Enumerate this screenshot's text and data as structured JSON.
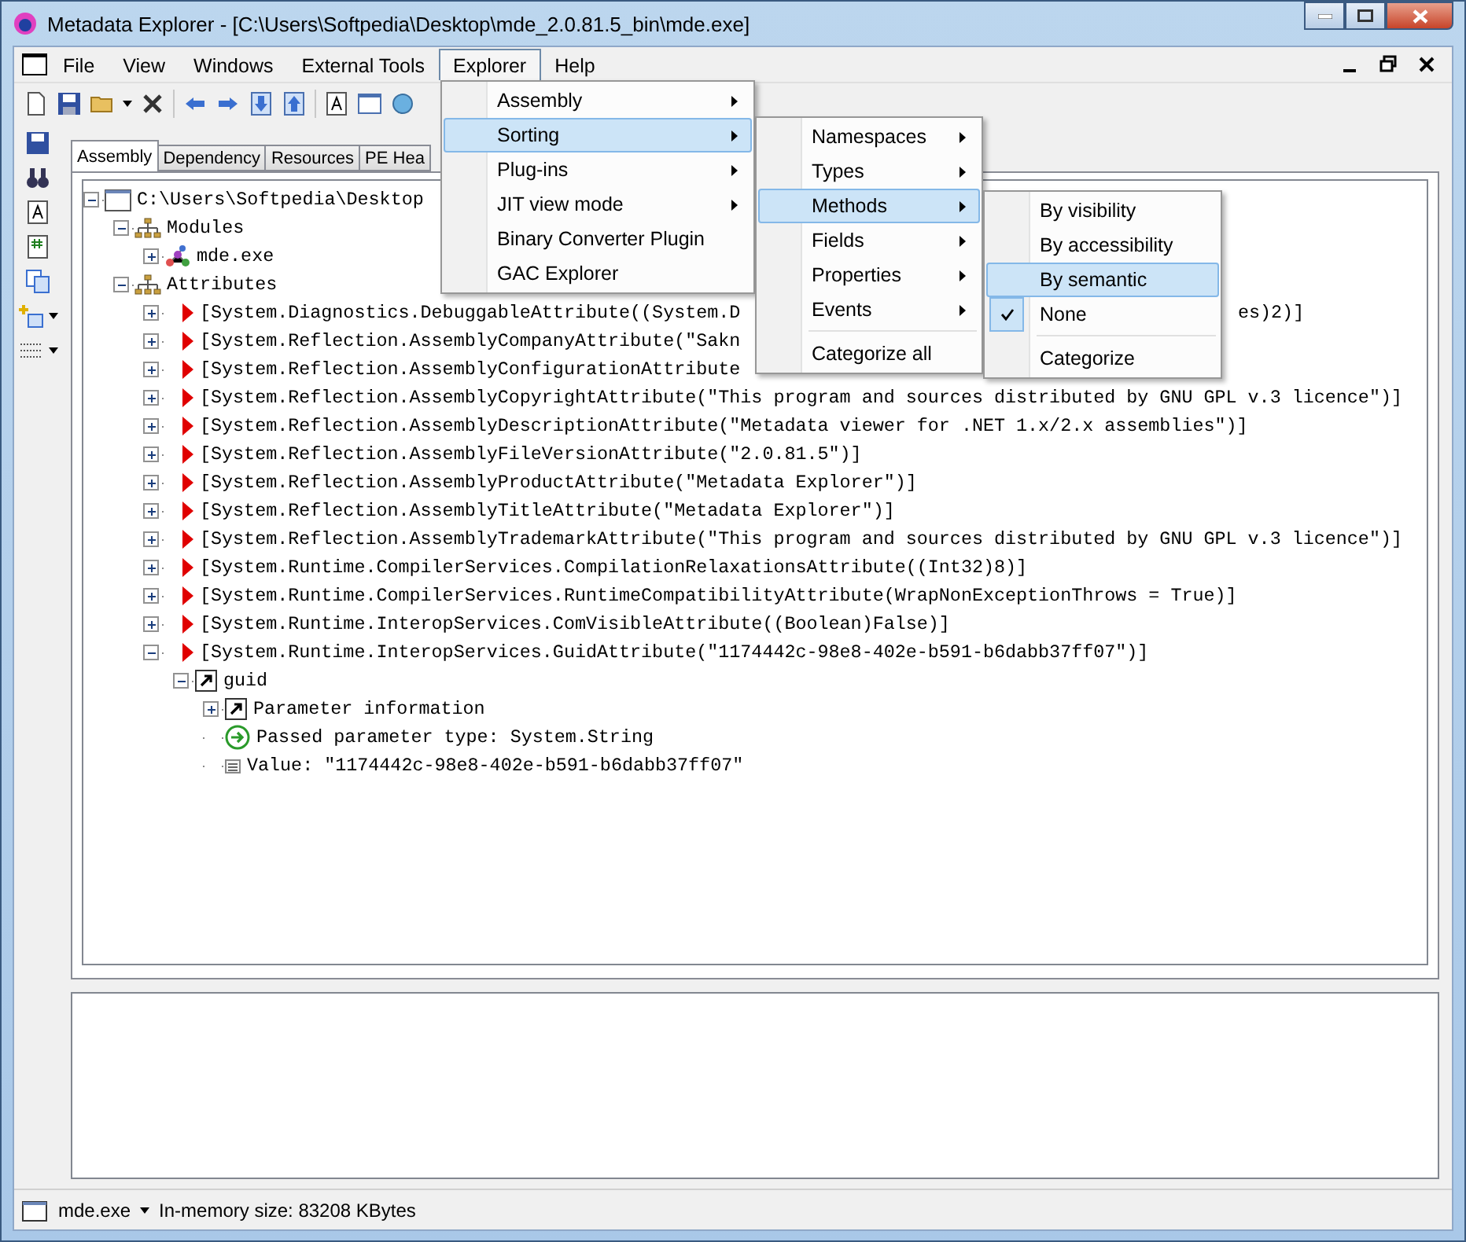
{
  "window": {
    "title": "Metadata Explorer - [C:\\Users\\Softpedia\\Desktop\\mde_2.0.81.5_bin\\mde.exe]"
  },
  "menu_bar": [
    {
      "label": "File",
      "selected": false
    },
    {
      "label": "View",
      "selected": false
    },
    {
      "label": "Windows",
      "selected": false
    },
    {
      "label": "External Tools",
      "selected": false
    },
    {
      "label": "Explorer",
      "selected": true
    },
    {
      "label": "Help",
      "selected": false
    }
  ],
  "tabs": [
    {
      "label": "Assembly",
      "selected": true
    },
    {
      "label": "Dependency",
      "selected": false
    },
    {
      "label": "Resources",
      "selected": false
    },
    {
      "label": "PE Hea",
      "selected": false
    }
  ],
  "tree": [
    {
      "label": "C:\\Users\\Softpedia\\Desktop",
      "kind": "root",
      "expanded": true,
      "children": [
        {
          "label": "Modules",
          "kind": "group",
          "expanded": true,
          "children": [
            {
              "label": "mde.exe",
              "kind": "module",
              "expanded": false
            }
          ]
        },
        {
          "label": "Attributes",
          "kind": "group",
          "expanded": true,
          "children": [
            {
              "label": "[System.Diagnostics.DebuggableAttribute((System.D",
              "label_after_menu": "es)2)]",
              "kind": "attribute",
              "expanded": false
            },
            {
              "label": "[System.Reflection.AssemblyCompanyAttribute(\"Sakn",
              "kind": "attribute",
              "expanded": false
            },
            {
              "label": "[System.Reflection.AssemblyConfigurationAttribute",
              "kind": "attribute",
              "expanded": false
            },
            {
              "label": "[System.Reflection.AssemblyCopyrightAttribute(\"This program and sources distributed by GNU GPL v.3 licence\")]",
              "kind": "attribute",
              "expanded": false
            },
            {
              "label": "[System.Reflection.AssemblyDescriptionAttribute(\"Metadata viewer for .NET 1.x/2.x assemblies\")]",
              "kind": "attribute",
              "expanded": false
            },
            {
              "label": "[System.Reflection.AssemblyFileVersionAttribute(\"2.0.81.5\")]",
              "kind": "attribute",
              "expanded": false
            },
            {
              "label": "[System.Reflection.AssemblyProductAttribute(\"Metadata Explorer\")]",
              "kind": "attribute",
              "expanded": false
            },
            {
              "label": "[System.Reflection.AssemblyTitleAttribute(\"Metadata Explorer\")]",
              "kind": "attribute",
              "expanded": false
            },
            {
              "label": "[System.Reflection.AssemblyTrademarkAttribute(\"This program and sources distributed by GNU GPL v.3 licence\")]",
              "kind": "attribute",
              "expanded": false
            },
            {
              "label": "[System.Runtime.CompilerServices.CompilationRelaxationsAttribute((Int32)8)]",
              "kind": "attribute",
              "expanded": false
            },
            {
              "label": "[System.Runtime.CompilerServices.RuntimeCompatibilityAttribute(WrapNonExceptionThrows = True)]",
              "kind": "attribute",
              "expanded": false
            },
            {
              "label": "[System.Runtime.InteropServices.ComVisibleAttribute((Boolean)False)]",
              "kind": "attribute",
              "expanded": false
            },
            {
              "label": "[System.Runtime.InteropServices.GuidAttribute(\"1174442c-98e8-402e-b591-b6dabb37ff07\")]",
              "kind": "attribute",
              "expanded": true,
              "children": [
                {
                  "label": "guid",
                  "kind": "parameter",
                  "expanded": true,
                  "children": [
                    {
                      "label": "Parameter information",
                      "kind": "parameter",
                      "expanded": false
                    },
                    {
                      "label": "Passed parameter type: System.String",
                      "kind": "type"
                    },
                    {
                      "label": "Value: \"1174442c-98e8-402e-b591-b6dabb37ff07\"",
                      "kind": "value"
                    }
                  ]
                }
              ]
            }
          ]
        }
      ]
    }
  ],
  "explorer_menu": [
    {
      "label": "Assembly",
      "has_submenu": true,
      "selected": false
    },
    {
      "label": "Sorting",
      "has_submenu": true,
      "selected": true
    },
    {
      "label": "Plug-ins",
      "has_submenu": true,
      "selected": false
    },
    {
      "label": "JIT view mode",
      "has_submenu": true,
      "selected": false
    },
    {
      "label": "Binary Converter Plugin",
      "has_submenu": false,
      "selected": false
    },
    {
      "label": "GAC Explorer",
      "has_submenu": false,
      "selected": false
    }
  ],
  "sorting_menu": [
    {
      "kind": "item",
      "label": "Namespaces",
      "has_submenu": true,
      "selected": false
    },
    {
      "kind": "item",
      "label": "Types",
      "has_submenu": true,
      "selected": false
    },
    {
      "kind": "item",
      "label": "Methods",
      "has_submenu": true,
      "selected": true
    },
    {
      "kind": "item",
      "label": "Fields",
      "has_submenu": true,
      "selected": false
    },
    {
      "kind": "item",
      "label": "Properties",
      "has_submenu": true,
      "selected": false
    },
    {
      "kind": "item",
      "label": "Events",
      "has_submenu": true,
      "selected": false
    },
    {
      "kind": "separator"
    },
    {
      "kind": "item",
      "label": "Categorize all",
      "has_submenu": false,
      "selected": false
    }
  ],
  "methods_menu": [
    {
      "kind": "item",
      "label": "By visibility",
      "selected": false,
      "checked": false
    },
    {
      "kind": "item",
      "label": "By accessibility",
      "selected": false,
      "checked": false
    },
    {
      "kind": "item",
      "label": "By semantic",
      "selected": true,
      "checked": false
    },
    {
      "kind": "item",
      "label": "None",
      "selected": false,
      "checked": true
    },
    {
      "kind": "separator"
    },
    {
      "kind": "item",
      "label": "Categorize",
      "selected": false,
      "checked": false
    }
  ],
  "status_bar": {
    "document": "mde.exe",
    "memory": "In-memory size: 83208 KBytes"
  }
}
